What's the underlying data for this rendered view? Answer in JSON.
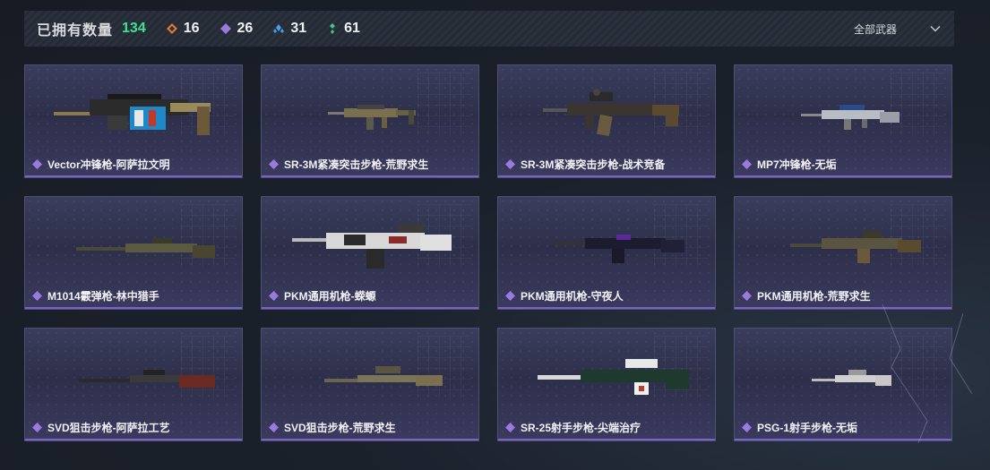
{
  "header": {
    "owned_label": "已拥有数量",
    "owned_count": "134",
    "stats": [
      {
        "icon": "orange-diamond-icon",
        "color": "#e0763a",
        "value": "16"
      },
      {
        "icon": "purple-diamond-icon",
        "color": "#9b7ae0",
        "value": "26"
      },
      {
        "icon": "blue-diamond-icon",
        "color": "#4aa0e8",
        "value": "31"
      },
      {
        "icon": "green-diamond-icon",
        "color": "#3ec98a",
        "value": "61"
      }
    ],
    "filter_label": "全部武器"
  },
  "colors": {
    "rarity": "#9b7ae0",
    "accent_line": "#7d62c7",
    "owned": "#3ee38f"
  },
  "items": [
    {
      "name": "Vector冲锋枪-阿萨拉文明",
      "rarity_icon": "purple-diamond-icon"
    },
    {
      "name": "SR-3M紧凑突击步枪-荒野求生",
      "rarity_icon": "purple-diamond-icon"
    },
    {
      "name": "SR-3M紧凑突击步枪-战术竞备",
      "rarity_icon": "purple-diamond-icon"
    },
    {
      "name": "MP7冲锋枪-无垢",
      "rarity_icon": "purple-diamond-icon"
    },
    {
      "name": "M1014霰弹枪-林中猎手",
      "rarity_icon": "purple-diamond-icon"
    },
    {
      "name": "PKM通用机枪-蝾螈",
      "rarity_icon": "purple-diamond-icon"
    },
    {
      "name": "PKM通用机枪-守夜人",
      "rarity_icon": "purple-diamond-icon"
    },
    {
      "name": "PKM通用机枪-荒野求生",
      "rarity_icon": "purple-diamond-icon"
    },
    {
      "name": "SVD狙击步枪-阿萨拉工艺",
      "rarity_icon": "purple-diamond-icon"
    },
    {
      "name": "SVD狙击步枪-荒野求生",
      "rarity_icon": "purple-diamond-icon"
    },
    {
      "name": "SR-25射手步枪-尖端治疗",
      "rarity_icon": "purple-diamond-icon"
    },
    {
      "name": "PSG-1射手步枪-无垢",
      "rarity_icon": "purple-diamond-icon"
    }
  ]
}
